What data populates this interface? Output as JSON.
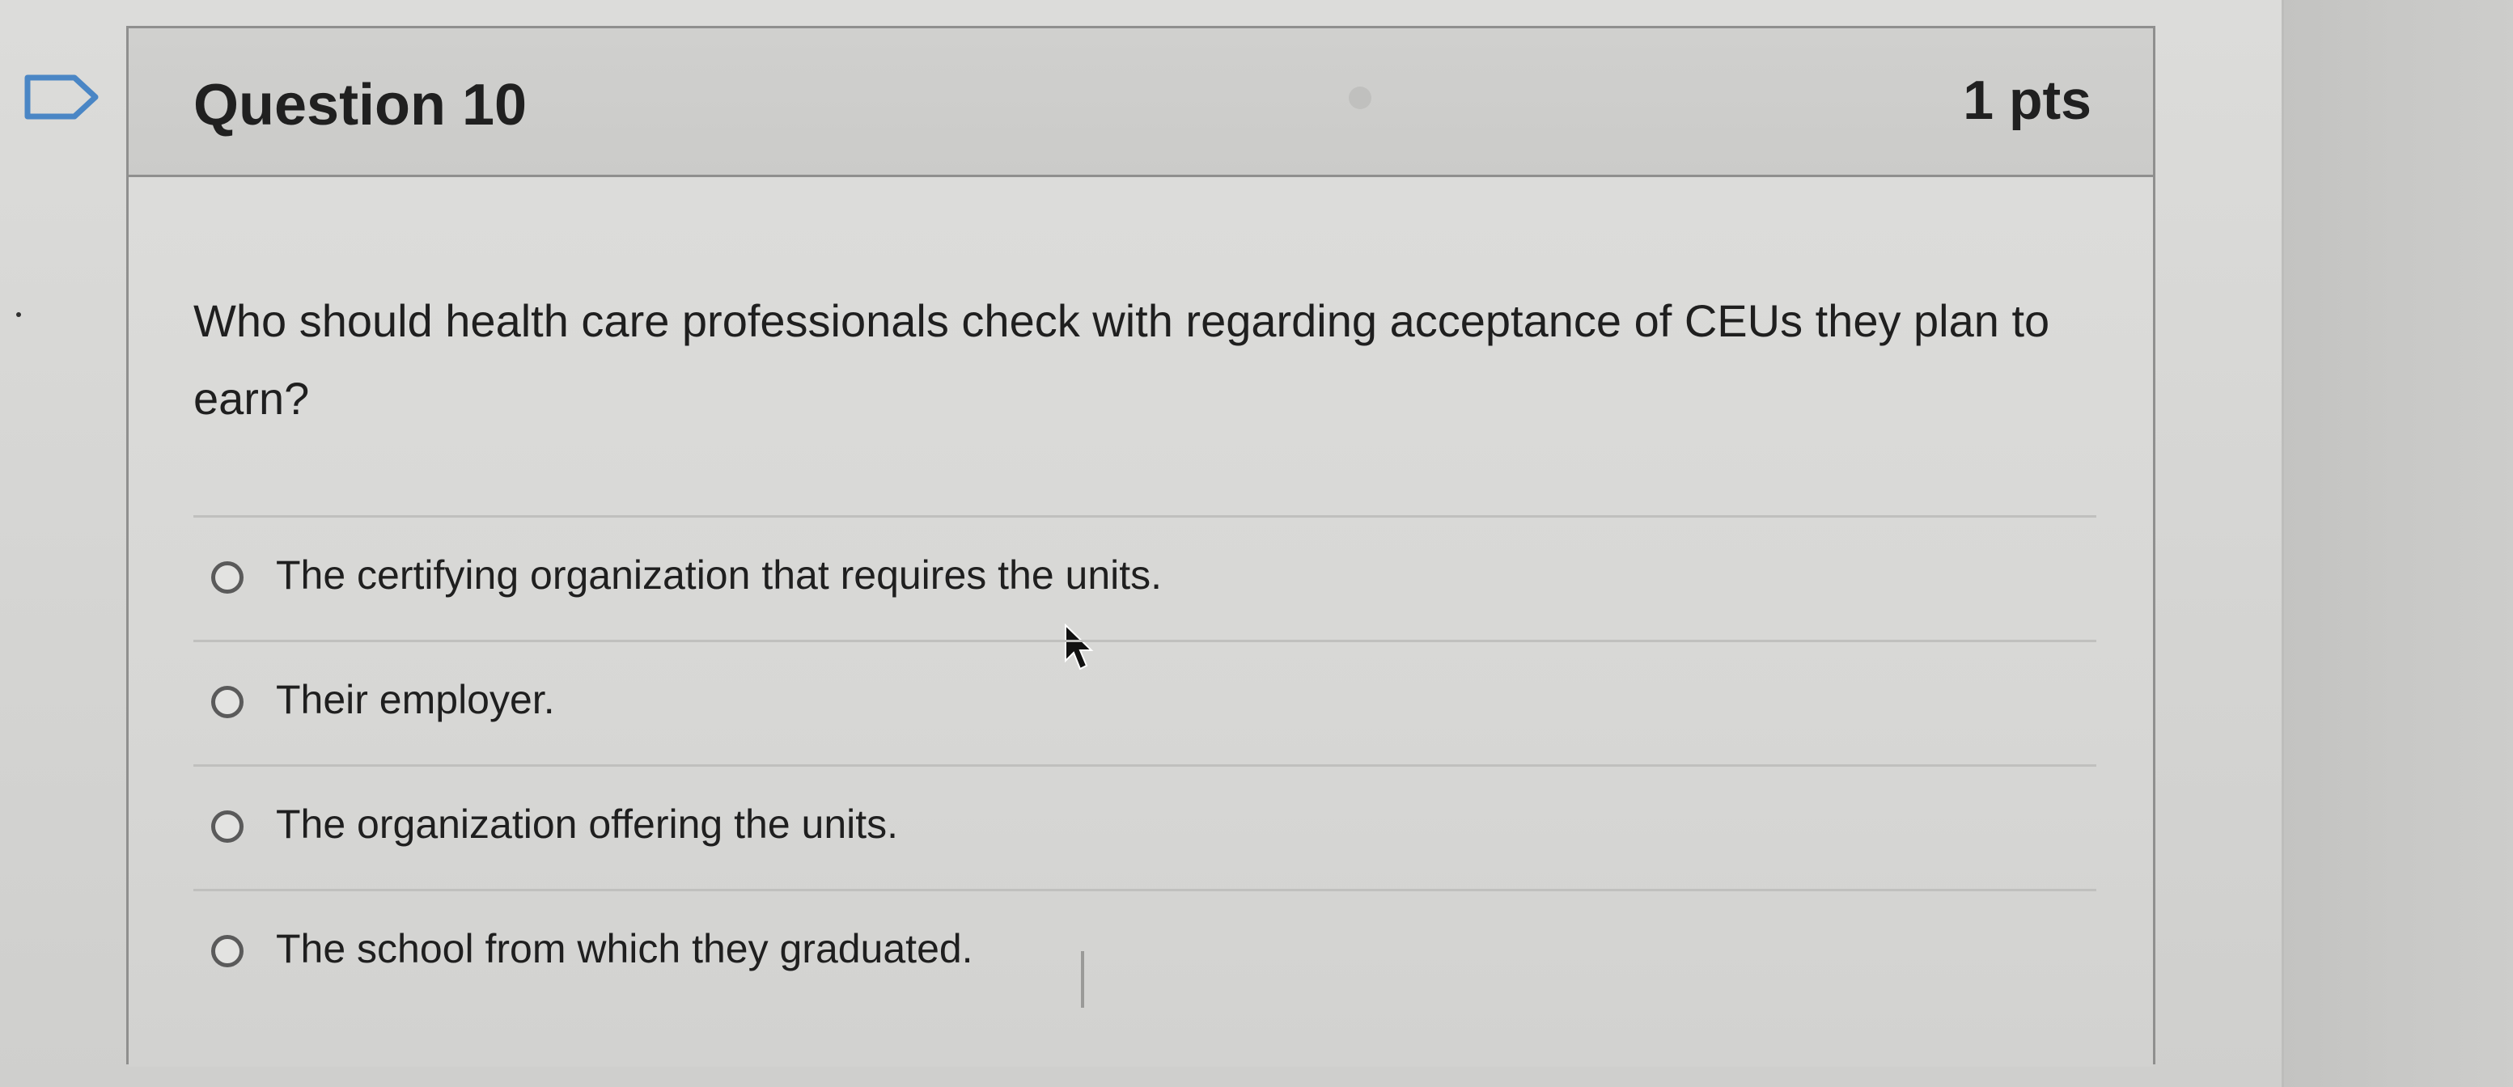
{
  "question": {
    "title": "Question 10",
    "points": "1 pts",
    "text": "Who should health care professionals check with regarding acceptance of CEUs they plan to earn?"
  },
  "answers": [
    {
      "label": "The certifying organization that requires the units."
    },
    {
      "label": "Their employer."
    },
    {
      "label": "The organization offering the units."
    },
    {
      "label": "The school from which they graduated."
    }
  ],
  "icons": {
    "flag": "flag-icon",
    "cursor": "mouse-pointer-icon"
  },
  "colors": {
    "flag_outline": "#4a86c5",
    "card_border": "#8f8f8e",
    "text": "#1f1f1f"
  }
}
